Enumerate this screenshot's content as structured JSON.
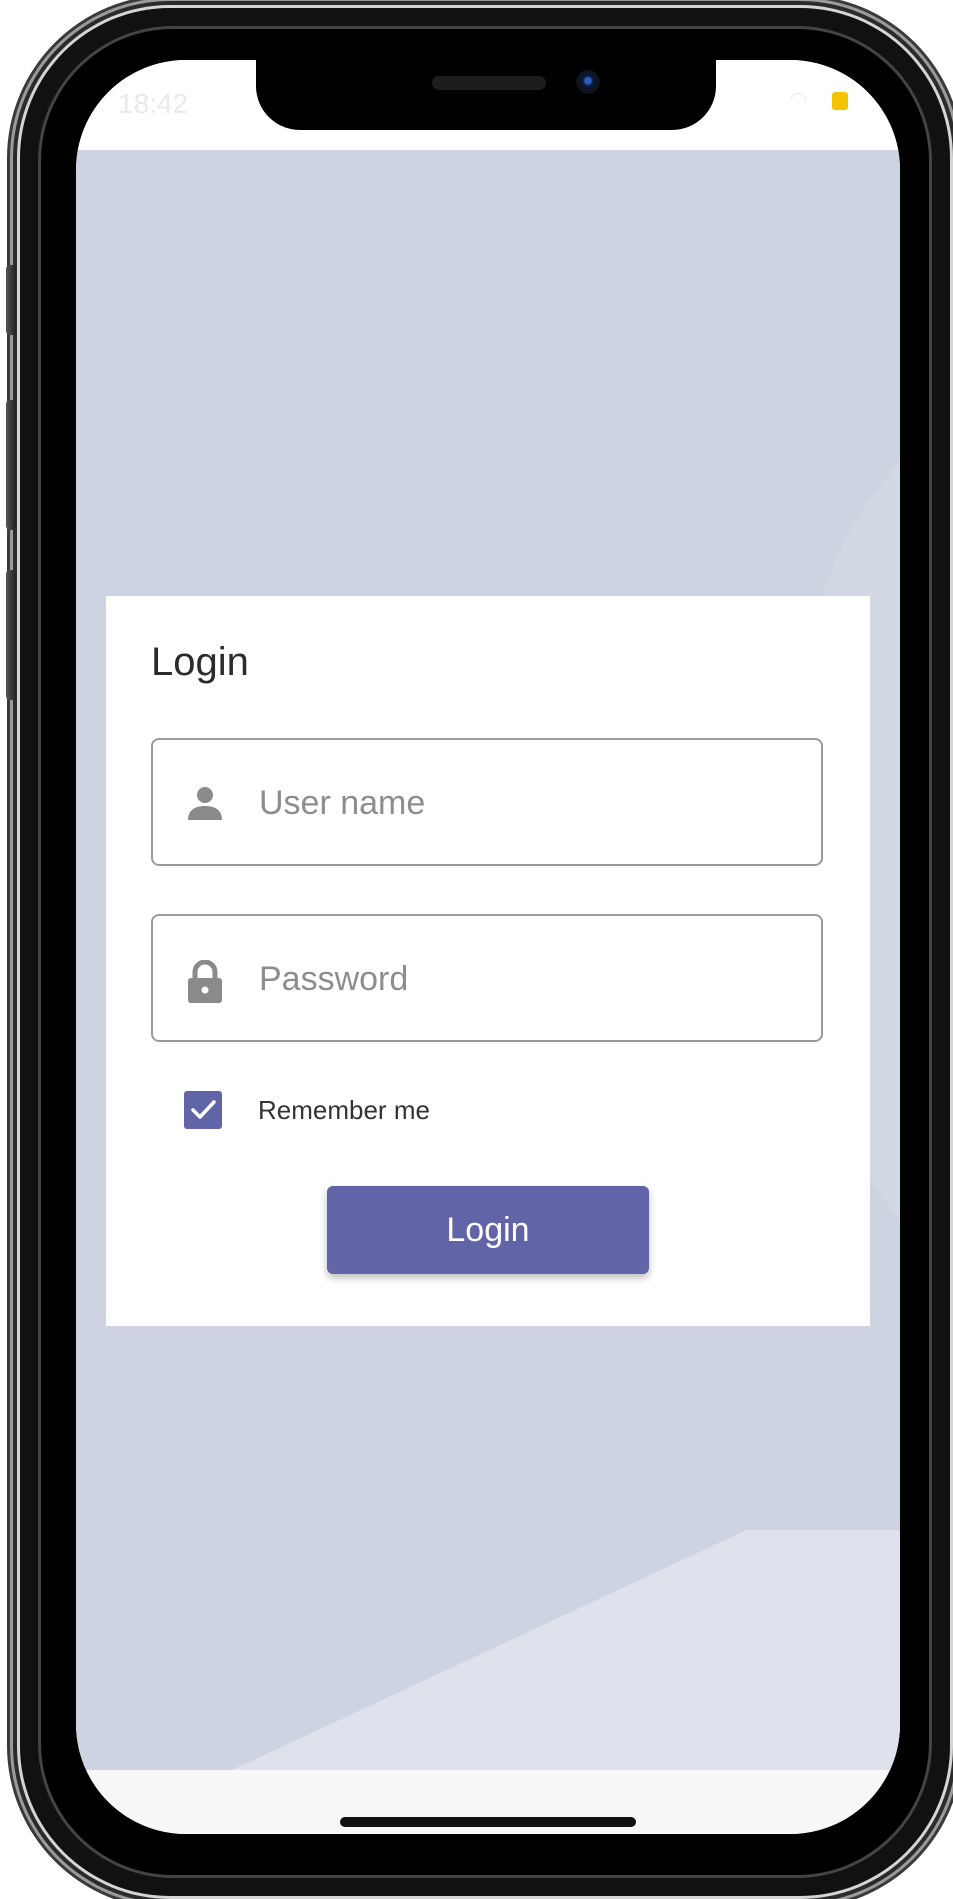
{
  "status_bar": {
    "time": "18:42",
    "wifi_icon": "wifi-icon",
    "battery_icon": "battery-icon"
  },
  "login": {
    "title": "Login",
    "username": {
      "placeholder": "User name",
      "value": "",
      "icon": "person-icon"
    },
    "password": {
      "placeholder": "Password",
      "value": "",
      "icon": "lock-icon"
    },
    "remember_me": {
      "label": "Remember me",
      "checked": true
    },
    "submit_label": "Login"
  },
  "colors": {
    "accent": "#6264a8",
    "background": "#cdd3e0",
    "card": "#ffffff",
    "icon": "#8a8a8a"
  }
}
